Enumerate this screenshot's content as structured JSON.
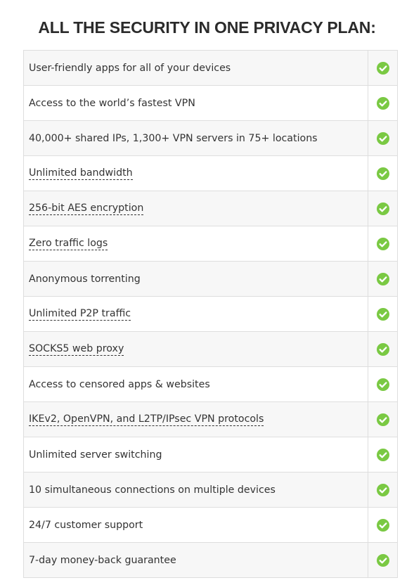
{
  "title": "ALL THE SECURITY IN ONE PRIVACY PLAN:",
  "colors": {
    "check": "#7ac943",
    "border": "#dedede",
    "row_alt": "#f7f7f7"
  },
  "features": [
    {
      "label": "User-friendly apps for all of your devices",
      "tooltip": false,
      "included": true,
      "icon": "check-circle-icon"
    },
    {
      "label": "Access to the world’s fastest VPN",
      "tooltip": false,
      "included": true,
      "icon": "check-circle-icon"
    },
    {
      "label": "40,000+ shared IPs, 1,300+ VPN servers in 75+ locations",
      "tooltip": false,
      "included": true,
      "icon": "check-circle-icon"
    },
    {
      "label": "Unlimited bandwidth",
      "tooltip": true,
      "included": true,
      "icon": "check-circle-icon"
    },
    {
      "label": "256-bit AES encryption",
      "tooltip": true,
      "included": true,
      "icon": "check-circle-icon"
    },
    {
      "label": "Zero traffic logs",
      "tooltip": true,
      "included": true,
      "icon": "check-circle-icon"
    },
    {
      "label": "Anonymous torrenting",
      "tooltip": false,
      "included": true,
      "icon": "check-circle-icon"
    },
    {
      "label": "Unlimited P2P traffic",
      "tooltip": true,
      "included": true,
      "icon": "check-circle-icon"
    },
    {
      "label": "SOCKS5 web proxy",
      "tooltip": true,
      "included": true,
      "icon": "check-circle-icon"
    },
    {
      "label": "Access to censored apps & websites",
      "tooltip": false,
      "included": true,
      "icon": "check-circle-icon"
    },
    {
      "label": "IKEv2, OpenVPN, and L2TP/IPsec VPN protocols",
      "tooltip": true,
      "included": true,
      "icon": "check-circle-icon"
    },
    {
      "label": "Unlimited server switching",
      "tooltip": false,
      "included": true,
      "icon": "check-circle-icon"
    },
    {
      "label": "10 simultaneous connections on multiple devices",
      "tooltip": false,
      "included": true,
      "icon": "check-circle-icon"
    },
    {
      "label": "24/7 customer support",
      "tooltip": false,
      "included": true,
      "icon": "check-circle-icon"
    },
    {
      "label": "7-day money-back guarantee",
      "tooltip": false,
      "included": true,
      "icon": "check-circle-icon"
    }
  ]
}
